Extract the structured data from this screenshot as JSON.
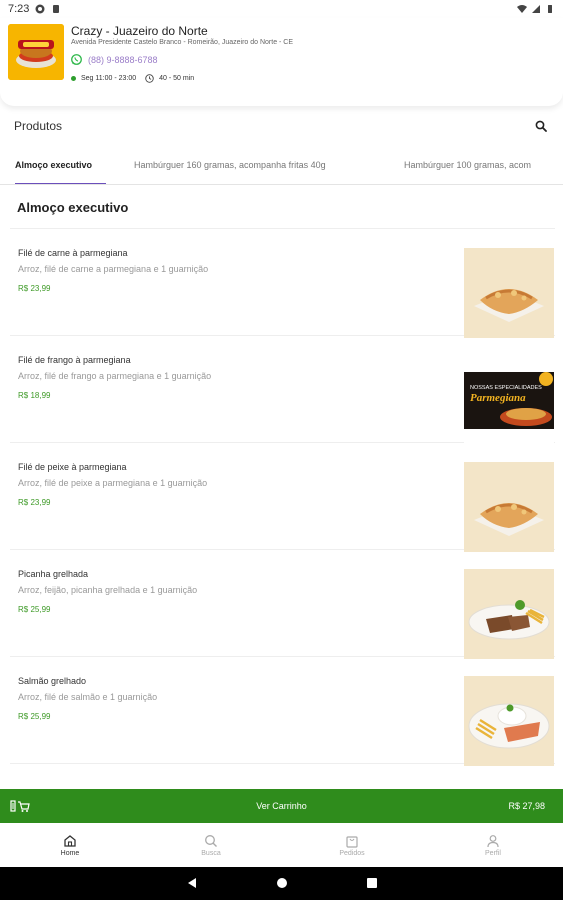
{
  "status_bar": {
    "time": "7:23"
  },
  "store": {
    "name": "Crazy - Juazeiro do Norte",
    "address": "Avenida Presidente Castelo Branco - Romeirão, Juazeiro do Norte - CE",
    "phone": "(88) 9-8888-6788",
    "hours": "Seg 11:00 - 23:00",
    "delivery_time": "40 - 50 min",
    "colors": {
      "open_dot": "#2e9e2e",
      "phone_text": "#9b7ec9",
      "logo_bg": "#f7b500"
    }
  },
  "products_header": {
    "title": "Produtos",
    "search_icon": "search-icon"
  },
  "tabs": [
    {
      "label": "Almoço executivo",
      "active": true
    },
    {
      "label": "Hambúrguer 160 gramas, acompanha fritas 40g",
      "active": false
    },
    {
      "label": "Hambúrguer 100 gramas, acom",
      "active": false
    }
  ],
  "section": {
    "title": "Almoço executivo"
  },
  "products": [
    {
      "name": "Filé de carne à parmegiana",
      "description": "Arroz, filé de carne a parmegiana e 1 guarnição",
      "price": "R$ 23,99",
      "image": "parmegiana-plate"
    },
    {
      "name": "Filé de frango à parmegiana",
      "description": "Arroz, filé de frango a parmegiana e 1 guarnição",
      "price": "R$ 18,99",
      "image": "parmegiana-banner"
    },
    {
      "name": "Filé de peixe à parmegiana",
      "description": "Arroz, filé de peixe a parmegiana e 1 guarnição",
      "price": "R$ 23,99",
      "image": "parmegiana-plate"
    },
    {
      "name": "Picanha grelhada",
      "description": "Arroz, feijão, picanha grelhada e 1 guarnição",
      "price": "R$ 25,99",
      "image": "picanha-plate"
    },
    {
      "name": "Salmão grelhado",
      "description": "Arroz, filé de salmão e 1 guarnição",
      "price": "R$ 25,99",
      "image": "salmon-plate"
    }
  ],
  "product_image_text": {
    "banner_line1": "NOSSAS ESPECIALIDADES",
    "banner_line2": "Parmegiana"
  },
  "cart": {
    "label": "Ver Carrinho",
    "total": "R$ 27,98",
    "color": "#2f8c1c"
  },
  "bottom_nav": [
    {
      "label": "Home",
      "icon": "home-icon",
      "active": true
    },
    {
      "label": "Busca",
      "icon": "search-icon",
      "active": false
    },
    {
      "label": "Pedidos",
      "icon": "bag-icon",
      "active": false
    },
    {
      "label": "Perfil",
      "icon": "person-icon",
      "active": false
    }
  ],
  "accent_color": "#6b4fbb"
}
